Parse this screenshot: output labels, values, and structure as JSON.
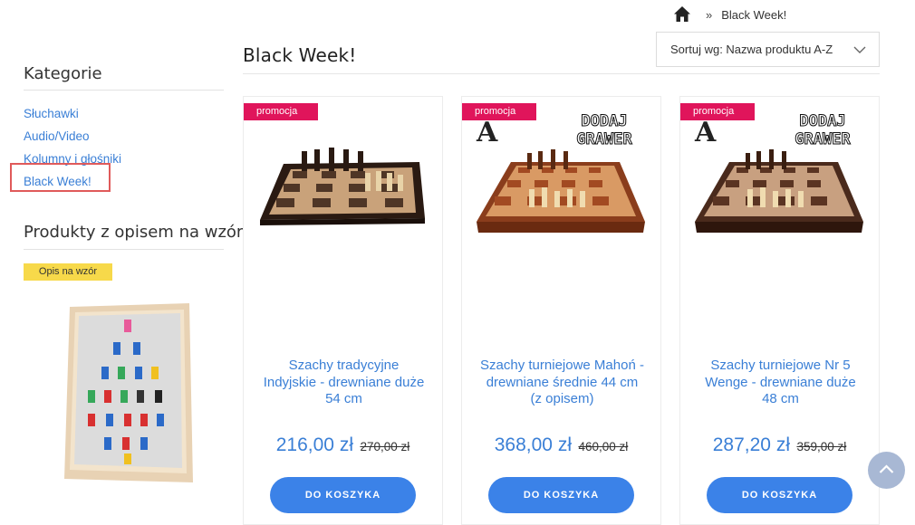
{
  "breadcrumb": {
    "home_icon": "home-icon",
    "separator": "»",
    "current": "Black Week!"
  },
  "sort": {
    "label": "Sortuj wg: Nazwa produktu A-Z",
    "icon": "chevron-down-icon"
  },
  "page": {
    "title": "Black Week!"
  },
  "sidebar": {
    "categories_heading": "Kategorie",
    "categories": [
      "Słuchawki",
      "Audio/Video",
      "Kolumny i głośniki",
      "Black Week!"
    ],
    "products_heading": "Produkty z opisem na wzór",
    "tag_label": "Opis na wzór"
  },
  "products": [
    {
      "badge": "promocja",
      "name": "Szachy tradycyjne Indyjskie - drewniane duże 54 cm",
      "price": "216,00 zł",
      "old_price": "270,00 zł",
      "button": "DO KOSZYKA",
      "grawer": ""
    },
    {
      "badge": "promocja",
      "name": "Szachy turniejowe Mahoń - drewniane średnie 44 cm (z opisem)",
      "price": "368,00 zł",
      "old_price": "460,00 zł",
      "button": "DO KOSZYKA",
      "grawer": "DODAJ GRAWER",
      "grawer_mark": "A"
    },
    {
      "badge": "promocja",
      "name": "Szachy turniejowe Nr 5 Wenge - drewniane duże 48 cm",
      "price": "287,20 zł",
      "old_price": "359,00 zł",
      "button": "DO KOSZYKA",
      "grawer": "DODAJ GRAWER",
      "grawer_mark": "A"
    }
  ],
  "colors": {
    "accent": "#3b82e8",
    "link": "#3a7fd6",
    "promo": "#e0155b",
    "tag": "#f7d94a",
    "highlight": "#e05a5a"
  }
}
